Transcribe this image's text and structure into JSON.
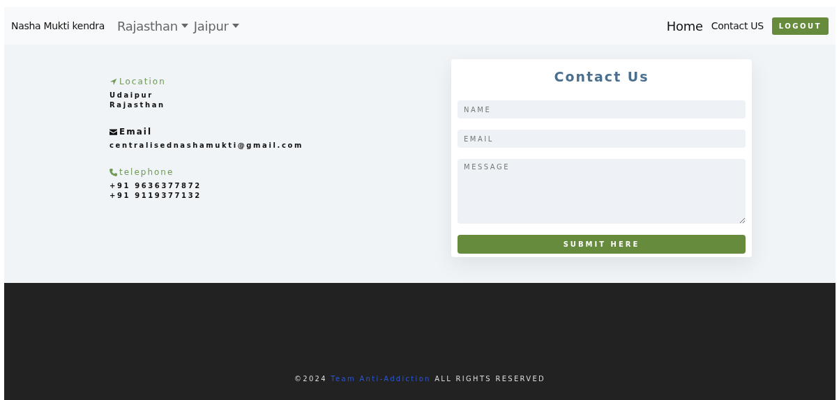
{
  "navbar": {
    "brand": "Nasha Mukti kendra",
    "dropdowns": [
      {
        "label": "Rajasthan"
      },
      {
        "label": "Jaipur"
      }
    ],
    "links": [
      {
        "label": "Home",
        "kind": "large"
      },
      {
        "label": "Contact US",
        "kind": "small"
      }
    ],
    "logout": "LOGOUT"
  },
  "contact_info": [
    {
      "kind": "location",
      "heading": "Location",
      "lines": [
        "Udaipur",
        "Rajasthan"
      ]
    },
    {
      "kind": "email",
      "heading": "Email",
      "lines": [
        "centralisednashamukti@gmail.com"
      ]
    },
    {
      "kind": "telephone",
      "heading": "telephone",
      "lines": [
        "+91 9636377872",
        "+91 9119377132"
      ]
    }
  ],
  "form": {
    "title": "Contact Us",
    "fields": [
      {
        "kind": "input",
        "placeholder": "NAME"
      },
      {
        "kind": "input",
        "placeholder": "EMAIL"
      },
      {
        "kind": "textarea",
        "placeholder": "MESSAGE"
      }
    ],
    "submit": "SUBMIT HERE"
  },
  "footer": {
    "prefix": "©2024 ",
    "link": "Team Anti-Addiction",
    "suffix": " ALL RIGHTS RESERVED"
  }
}
